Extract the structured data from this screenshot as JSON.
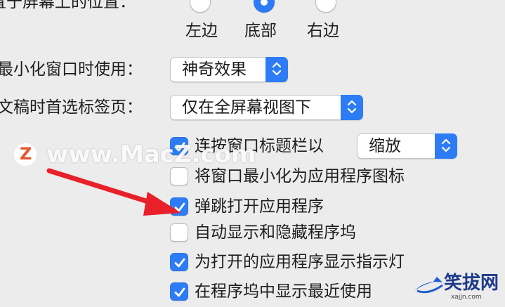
{
  "position_row": {
    "label": "置于屏幕上的位置：",
    "options": [
      "左边",
      "底部",
      "右边"
    ],
    "selected": "底部"
  },
  "minimize_row": {
    "label": "最小化窗口时使用：",
    "value": "神奇效果"
  },
  "tabs_row": {
    "label": "文稿时首选标签页：",
    "value": "仅在全屏幕视图下"
  },
  "double_click_row": {
    "label": "连按窗口标题栏以",
    "checked": true,
    "value": "缩放"
  },
  "checkboxes": [
    {
      "label": "将窗口最小化为应用程序图标",
      "checked": false
    },
    {
      "label": "弹跳打开应用程序",
      "checked": true
    },
    {
      "label": "自动显示和隐藏程序坞",
      "checked": false
    },
    {
      "label": "为打开的应用程序显示指示灯",
      "checked": true
    },
    {
      "label": "在程序坞中显示最近使用",
      "checked": true
    }
  ],
  "watermark": {
    "text": "www.MacZ.com",
    "logo_letter": "Z"
  },
  "corner_watermark": {
    "text": "笑拔网",
    "subtext": "xajjn.com"
  },
  "colors": {
    "accent": "#2d7cf6",
    "arrow": "#e8202a",
    "background": "#ececec"
  }
}
